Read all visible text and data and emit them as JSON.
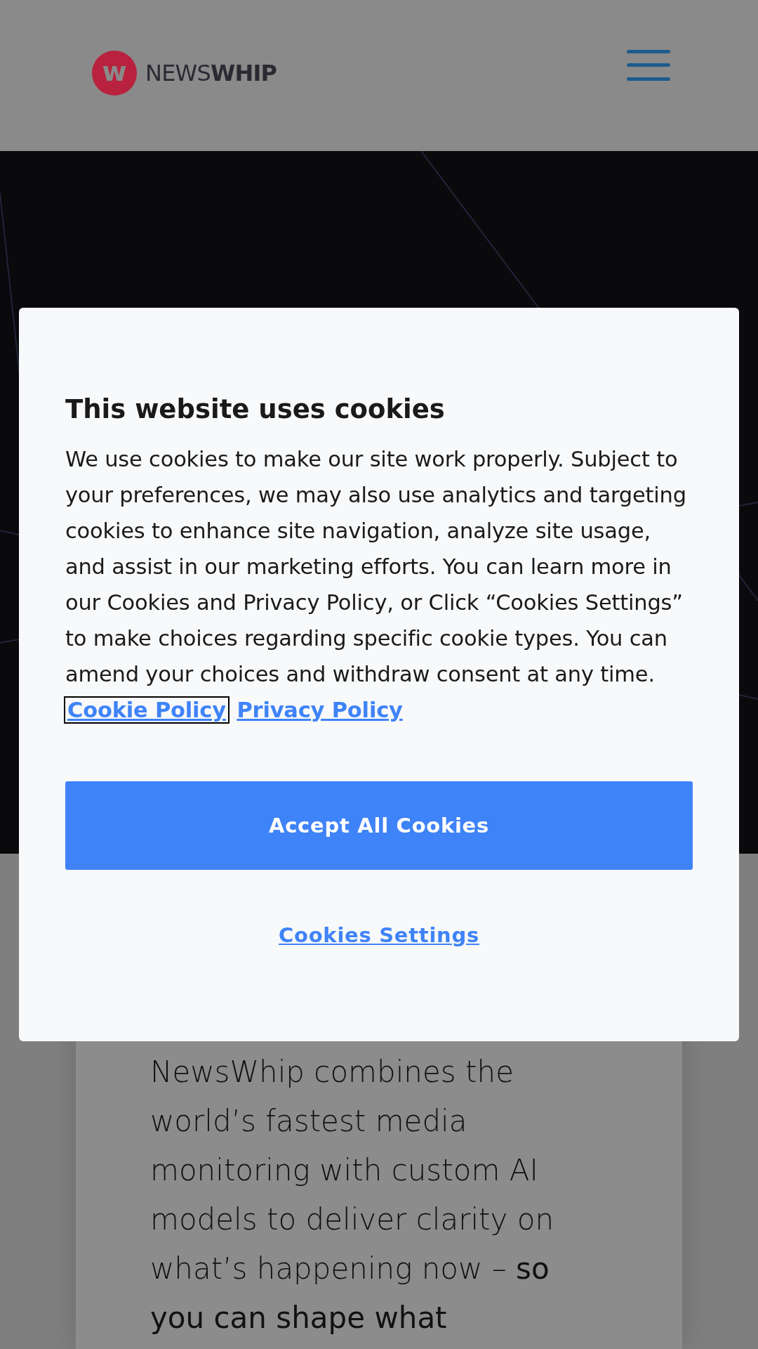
{
  "header": {
    "logo_mark": "w",
    "logo_text": "NEWS**WHIP**"
  },
  "intro": {
    "text": "NewsWhip combines the world’s fastest media monitoring with custom AI models to deliver clarity on what’s happening now – **so you can shape what**"
  },
  "cookie_dialog": {
    "title": "This website uses cookies",
    "body": "We use cookies to make our site work properly. Subject to your preferences, we may also use analytics and targeting cookies to enhance site navigation, analyze site usage, and assist in our marketing efforts. You can learn more in our Cookies and Privacy Policy, or Click “Cookies Settings” to make choices regarding specific cookie types. You can amend your choices and withdraw consent at any time.",
    "links": [
      {
        "label": "Cookie Policy",
        "focused": true
      },
      {
        "label": "Privacy Policy",
        "focused": false
      }
    ],
    "accept_button": "Accept All Cookies",
    "settings_button": "Cookies Settings"
  }
}
